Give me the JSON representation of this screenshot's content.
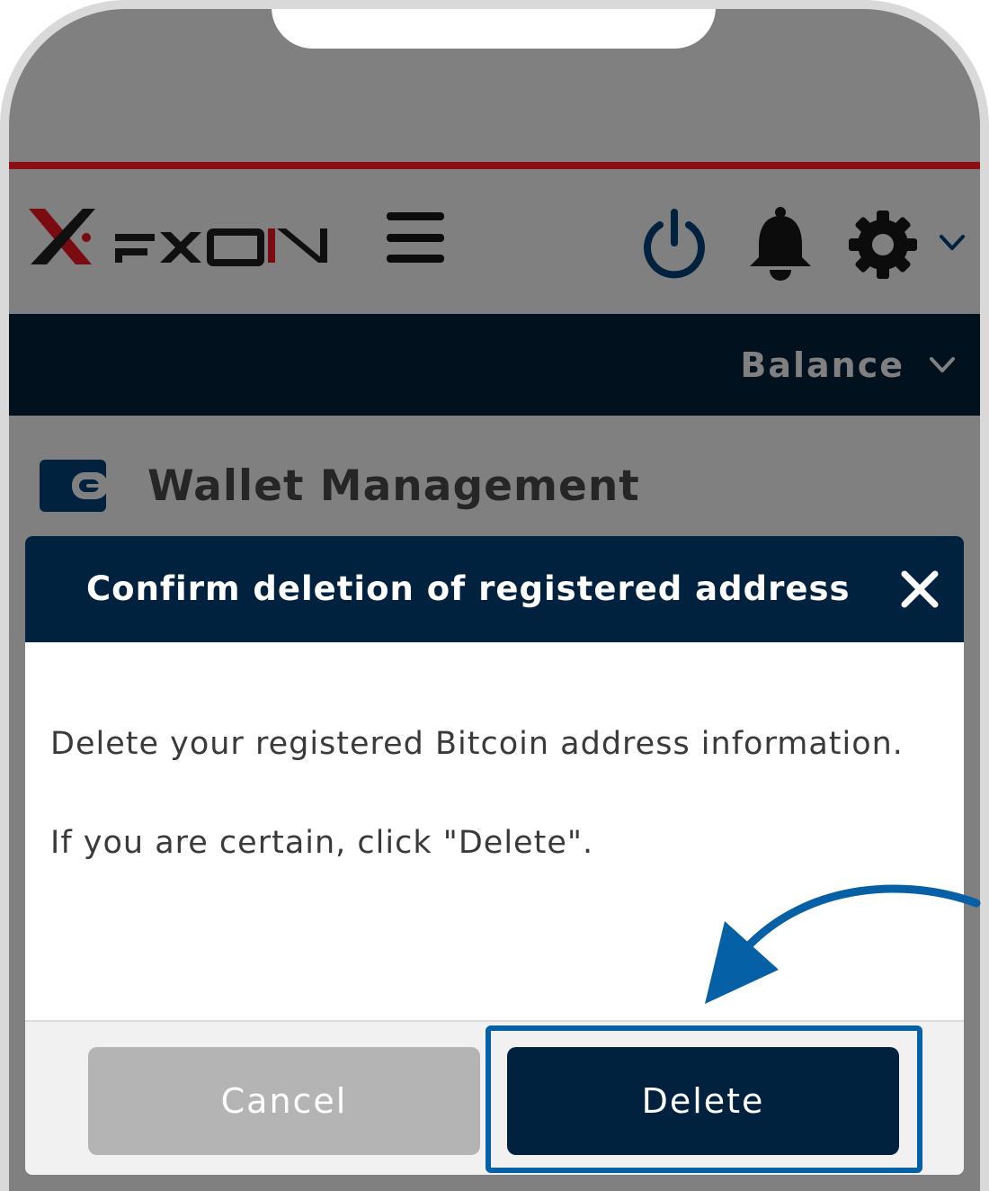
{
  "app": {
    "brand": "FXON"
  },
  "header": {
    "icons": [
      "power-icon",
      "bell-icon",
      "gear-icon",
      "chevron-down-icon"
    ]
  },
  "nav": {
    "balance_label": "Balance"
  },
  "page": {
    "title": "Wallet Management",
    "icon": "wallet-icon"
  },
  "modal": {
    "title": "Confirm deletion of registered address",
    "body_line1": "Delete your registered Bitcoin address information.",
    "body_line2": "If you are certain, click \"Delete\".",
    "cancel_label": "Cancel",
    "delete_label": "Delete"
  },
  "colors": {
    "overlay_gray": "#808080",
    "accent_red": "#8a0e14",
    "navy_nav": "#01111e",
    "navy_modal": "#01223f",
    "highlight_blue": "#0660a6",
    "cancel_gray": "#b4b4b4"
  }
}
